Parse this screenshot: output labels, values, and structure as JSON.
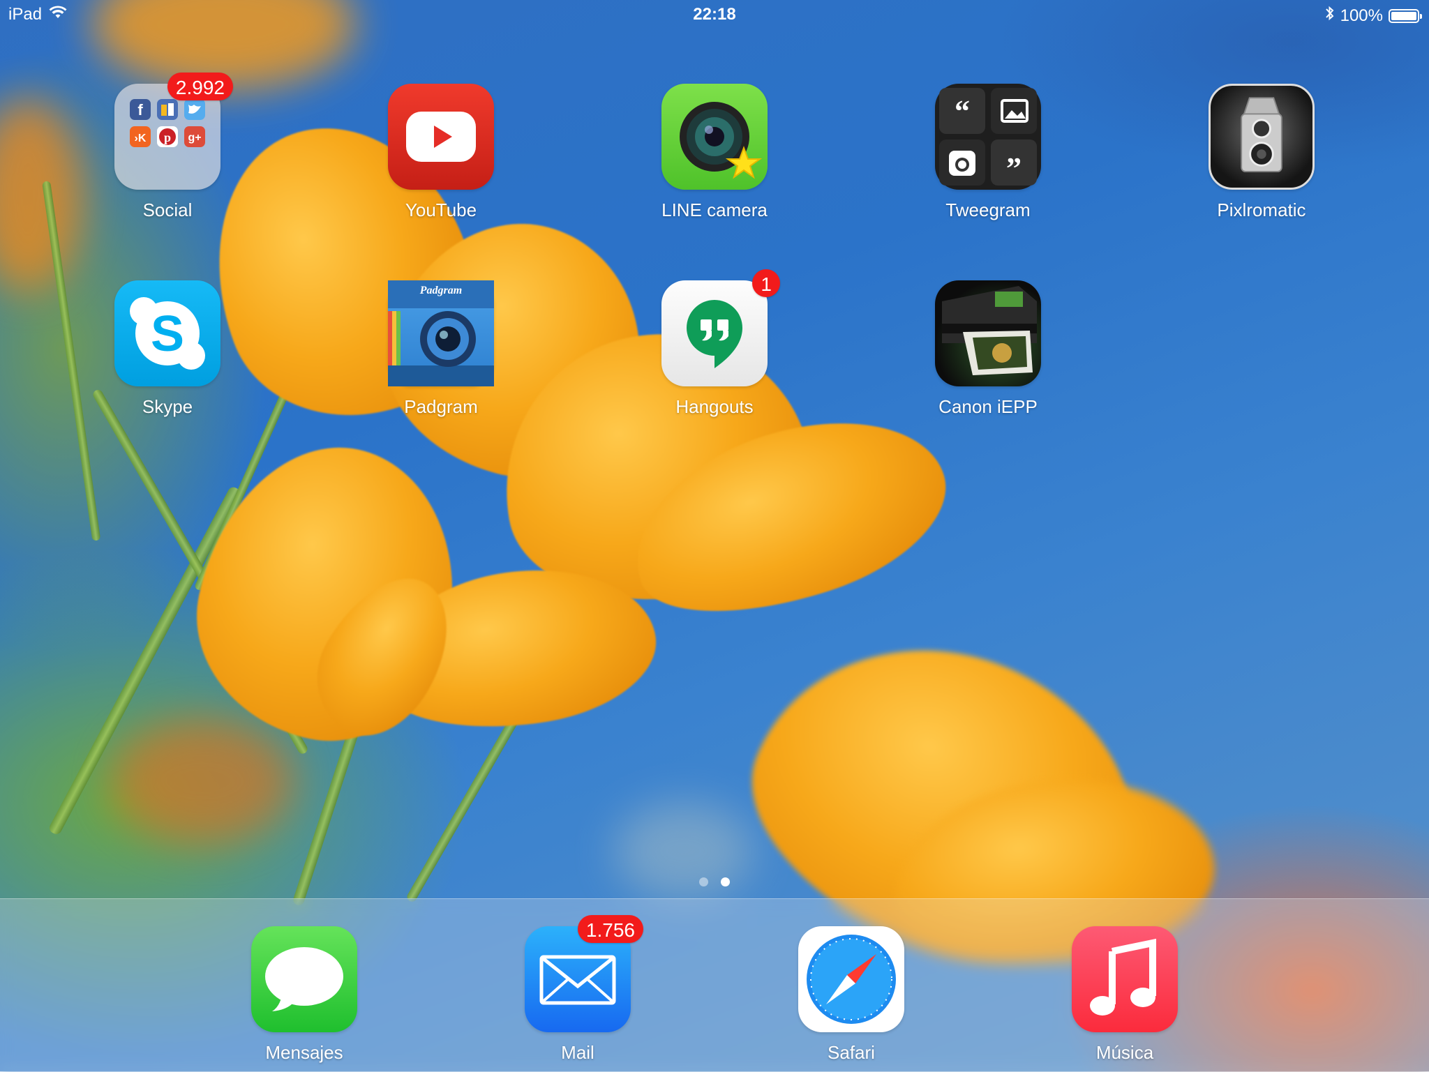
{
  "status_bar": {
    "device": "iPad",
    "time": "22:18",
    "battery_percent": "100%",
    "battery_level": 1.0,
    "icons": [
      "wifi-icon",
      "bluetooth-icon",
      "battery-icon"
    ]
  },
  "apps": [
    {
      "name": "Social",
      "badge": "2.992",
      "icon": "folder-icon"
    },
    {
      "name": "YouTube",
      "badge": "",
      "icon": "youtube-icon"
    },
    {
      "name": "LINE camera",
      "badge": "",
      "icon": "line-camera-icon"
    },
    {
      "name": "Tweegram",
      "badge": "",
      "icon": "tweegram-icon"
    },
    {
      "name": "Pixlromatic",
      "badge": "",
      "icon": "pixlromatic-icon"
    },
    {
      "name": "Skype",
      "badge": "",
      "icon": "skype-icon"
    },
    {
      "name": "Padgram",
      "badge": "",
      "icon": "padgram-icon"
    },
    {
      "name": "Hangouts",
      "badge": "1",
      "icon": "hangouts-icon"
    },
    {
      "name": "Canon iEPP",
      "badge": "",
      "icon": "canon-iepp-icon"
    }
  ],
  "padgram_logo_text": "Padgram",
  "page_dots": {
    "count": 2,
    "active_index": 1
  },
  "dock": [
    {
      "name": "Mensajes",
      "badge": "",
      "icon": "messages-icon"
    },
    {
      "name": "Mail",
      "badge": "1.756",
      "icon": "mail-icon"
    },
    {
      "name": "Safari",
      "badge": "",
      "icon": "safari-icon"
    },
    {
      "name": "Música",
      "badge": "",
      "icon": "music-icon"
    }
  ],
  "colors": {
    "badge": "#f21b1b",
    "youtube": "#e52d27",
    "line_camera": "#5fd334",
    "skype": "#00aff0",
    "hangouts": "#0f9d58",
    "messages": "#4cd964",
    "mail": "#1e8ef5",
    "music": "#fd2d55"
  }
}
